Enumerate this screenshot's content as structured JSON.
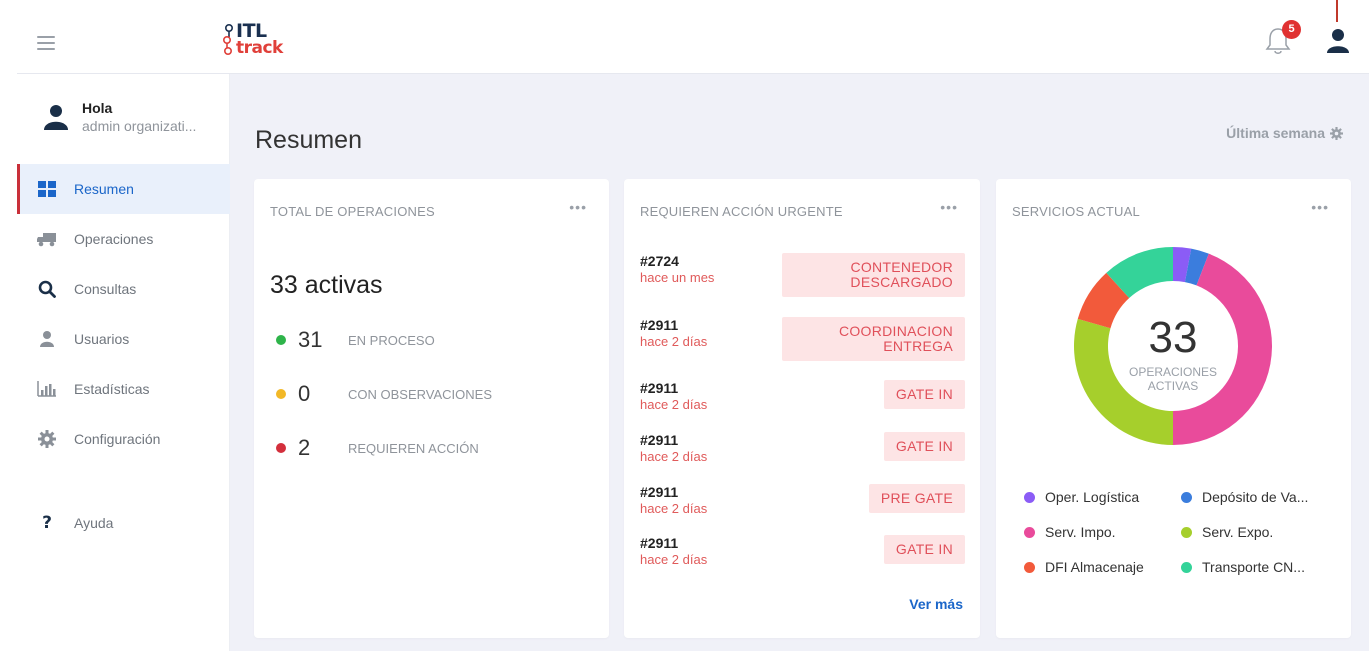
{
  "header": {
    "menu_icon": "hamburger-icon",
    "logo_top": "ITL",
    "logo_bottom": "track",
    "notification_count": "5",
    "bell_icon": "bell-icon",
    "user_icon": "user-icon"
  },
  "sidebar": {
    "greeting": "Hola",
    "user_name": "admin organizati...",
    "items": [
      {
        "label": "Resumen",
        "icon": "grid-icon",
        "active": true
      },
      {
        "label": "Operaciones",
        "icon": "truck-icon"
      },
      {
        "label": "Consultas",
        "icon": "search-icon"
      },
      {
        "label": "Usuarios",
        "icon": "user-icon"
      },
      {
        "label": "Estadísticas",
        "icon": "bar-chart-icon"
      },
      {
        "label": "Configuración",
        "icon": "gear-icon"
      },
      {
        "label": "Ayuda",
        "icon": "question-icon"
      }
    ]
  },
  "main": {
    "title": "Resumen",
    "period": "Última semana",
    "total_card": {
      "title": "TOTAL DE OPERACIONES",
      "active": "33 activas",
      "stats": [
        {
          "value": "31",
          "label": "EN PROCESO",
          "color": "#2eb44a"
        },
        {
          "value": "0",
          "label": "CON OBSERVACIONES",
          "color": "#f2b827"
        },
        {
          "value": "2",
          "label": "REQUIEREN ACCIÓN",
          "color": "#d32f3c"
        }
      ]
    },
    "urgent_card": {
      "title": "REQUIEREN ACCIÓN URGENTE",
      "items": [
        {
          "id": "#2724",
          "when": "hace un mes",
          "status": "CONTENEDOR DESCARGADO"
        },
        {
          "id": "#2911",
          "when": "hace 2 días",
          "status": "COORDINACION ENTREGA"
        },
        {
          "id": "#2911",
          "when": "hace 2 días",
          "status": "GATE IN"
        },
        {
          "id": "#2911",
          "when": "hace 2 días",
          "status": "GATE IN"
        },
        {
          "id": "#2911",
          "when": "hace 2 días",
          "status": "PRE GATE"
        },
        {
          "id": "#2911",
          "when": "hace 2 días",
          "status": "GATE IN"
        }
      ],
      "more": "Ver más"
    },
    "services_card": {
      "title": "SERVICIOS ACTUAL",
      "total": "33",
      "total_label": "OPERACIONES ACTIVAS"
    }
  },
  "chart_data": {
    "type": "pie",
    "categories": [
      "Oper. Logística",
      "Depósito de Va...",
      "Serv. Impo.",
      "Serv. Expo.",
      "DFI Almacenaje",
      "Transporte CN..."
    ],
    "values": [
      1,
      1,
      15,
      10,
      3,
      4
    ],
    "colors": [
      "#8b5cf6",
      "#3b7ddd",
      "#e94b9b",
      "#a6cf2c",
      "#f25a3b",
      "#34d399"
    ],
    "legend": "bottom",
    "center_text": "33"
  }
}
